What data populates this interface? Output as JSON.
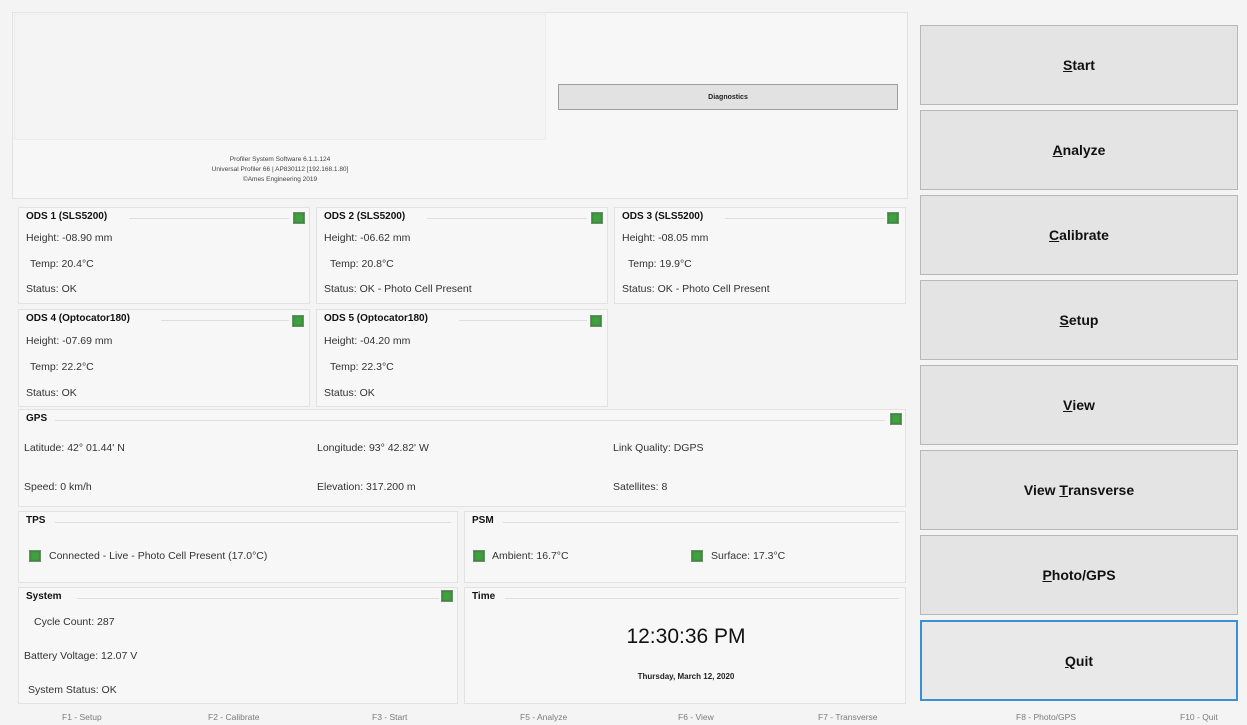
{
  "header": {
    "version_lines": [
      "Profiler System Software 6.1.1.124",
      "Universal Profiler 66 | AP830112 [192.168.1.80]",
      "©Ames Engineering 2019"
    ],
    "diagnostics_label": "Diagnostics"
  },
  "ods": [
    {
      "title": "ODS 1 (SLS5200)",
      "height": "Height:  -08.90 mm",
      "temp": "Temp:  20.4°C",
      "status": "Status:  OK"
    },
    {
      "title": "ODS 2 (SLS5200)",
      "height": "Height:  -06.62 mm",
      "temp": "Temp:  20.8°C",
      "status": "Status:  OK - Photo Cell Present"
    },
    {
      "title": "ODS 3 (SLS5200)",
      "height": "Height:  -08.05 mm",
      "temp": "Temp:  19.9°C",
      "status": "Status:  OK - Photo Cell Present"
    },
    {
      "title": "ODS 4 (Optocator180)",
      "height": "Height:  -07.69 mm",
      "temp": "Temp:  22.2°C",
      "status": "Status:  OK"
    },
    {
      "title": "ODS 5 (Optocator180)",
      "height": "Height:  -04.20 mm",
      "temp": "Temp:  22.3°C",
      "status": "Status:  OK"
    }
  ],
  "gps": {
    "title": "GPS",
    "latitude": "Latitude: 42° 01.44' N",
    "longitude": "Longitude: 93° 42.82' W",
    "link_quality": "Link Quality: DGPS",
    "speed": "Speed: 0 km/h",
    "elevation": "Elevation: 317.200 m",
    "satellites": "Satellites: 8"
  },
  "tps": {
    "title": "TPS",
    "status": "Connected - Live  - Photo Cell Present (17.0°C)"
  },
  "psm": {
    "title": "PSM",
    "ambient": "Ambient: 16.7°C",
    "surface": "Surface: 17.3°C"
  },
  "system": {
    "title": "System",
    "cycle_count": "Cycle Count:  287",
    "battery_voltage": "Battery Voltage:  12.07 V",
    "system_status": "System Status:  OK"
  },
  "time": {
    "title": "Time",
    "clock": "12:30:36 PM",
    "date": "Thursday, March 12, 2020"
  },
  "side_buttons": [
    {
      "mnemonic": "S",
      "rest": "tart"
    },
    {
      "mnemonic": "A",
      "rest": "nalyze"
    },
    {
      "mnemonic": "C",
      "rest": "alibrate"
    },
    {
      "mnemonic": "S",
      "rest": "etup"
    },
    {
      "mnemonic": "V",
      "rest": "iew"
    },
    {
      "prefix": "View ",
      "mnemonic": "T",
      "rest": "ransverse"
    },
    {
      "mnemonic": "P",
      "rest": "hoto/GPS"
    },
    {
      "mnemonic": "Q",
      "rest": "uit"
    }
  ],
  "fkeys": [
    "F1 - Setup",
    "F2 - Calibrate",
    "F3 - Start",
    "F5 - Analyze",
    "F6 - View",
    "F7 - Transverse",
    "F8 - Photo/GPS",
    "F10 - Quit"
  ],
  "colors": {
    "led_green": "#41a141",
    "quit_border": "#3c8fd6",
    "button_bg": "#e4e4e4"
  }
}
